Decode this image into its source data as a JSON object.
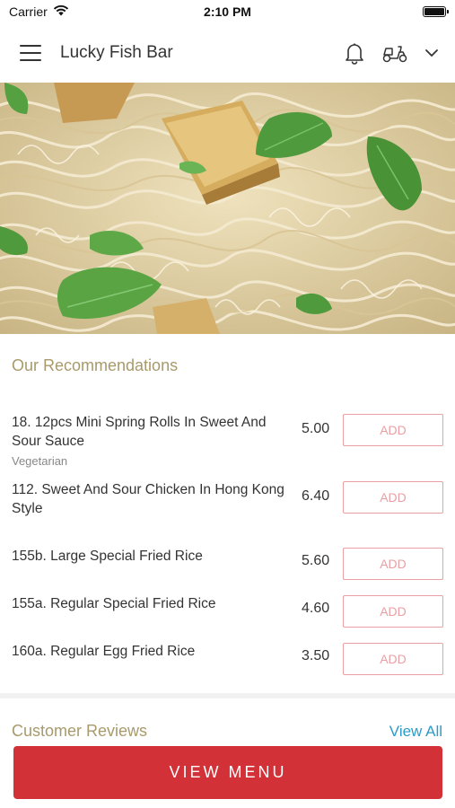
{
  "status_bar": {
    "carrier": "Carrier",
    "time": "2:10 PM",
    "icons": [
      "wifi-icon",
      "battery-icon"
    ]
  },
  "header": {
    "title": "Lucky Fish Bar",
    "icons": [
      "menu-icon",
      "bell-icon",
      "scooter-icon",
      "chevron-down-icon"
    ]
  },
  "hero": {
    "description_icon": "noodles-photo"
  },
  "recommendations": {
    "title": "Our Recommendations",
    "items": [
      {
        "name": "18. 12pcs Mini Spring Rolls In Sweet And Sour Sauce",
        "subtitle": "Vegetarian",
        "price": "5.00",
        "button": "ADD"
      },
      {
        "name": "112. Sweet And Sour Chicken In Hong Kong Style",
        "subtitle": "",
        "price": "6.40",
        "button": "ADD"
      },
      {
        "name": "155b. Large Special Fried Rice",
        "subtitle": "",
        "price": "5.60",
        "button": "ADD"
      },
      {
        "name": "155a. Regular Special Fried Rice",
        "subtitle": "",
        "price": "4.60",
        "button": "ADD"
      },
      {
        "name": "160a. Regular Egg Fried Rice",
        "subtitle": "",
        "price": "3.50",
        "button": "ADD"
      }
    ]
  },
  "reviews": {
    "title": "Customer Reviews",
    "view_all": "View All"
  },
  "footer": {
    "button": "VIEW MENU"
  },
  "colors": {
    "accent_red": "#d23138",
    "section_title": "#a89a6b",
    "link_blue": "#2d9bc8",
    "add_border": "#e8a0a4"
  }
}
